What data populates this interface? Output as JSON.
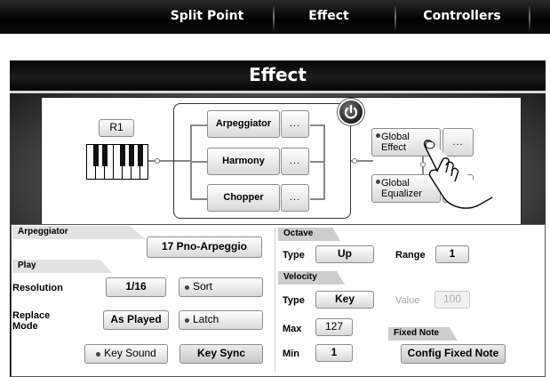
{
  "tabs": [
    {
      "label": "Split Point"
    },
    {
      "label": "Effect"
    },
    {
      "label": "Controllers"
    }
  ],
  "panel_title": "Effect",
  "routing": {
    "keyboard_label": "R1",
    "effects": [
      {
        "label": "Arpeggiator",
        "more": "..."
      },
      {
        "label": "Harmony",
        "more": "..."
      },
      {
        "label": "Chopper",
        "more": "..."
      }
    ],
    "global_effect": {
      "label": "Global Effect",
      "more": "..."
    },
    "global_equalizer": {
      "label": "Global Equalizer",
      "more": "..."
    },
    "power_icon": "power-icon"
  },
  "arpeggiator": {
    "header": "Arpeggiator",
    "preset": "17 Pno-Arpeggio",
    "play_header": "Play",
    "resolution_label": "Resolution",
    "resolution_value": "1/16",
    "sort_label": "Sort",
    "replace_mode_label": "Replace Mode",
    "replace_mode_value": "As Played",
    "latch_label": "Latch",
    "key_sound_label": "Key Sound",
    "key_sync_label": "Key Sync"
  },
  "octave": {
    "header": "Octave",
    "type_label": "Type",
    "type_value": "Up",
    "range_label": "Range",
    "range_value": "1"
  },
  "velocity": {
    "header": "Velocity",
    "type_label": "Type",
    "type_value": "Key",
    "value_label": "Value",
    "value_value": "100",
    "max_label": "Max",
    "max_value": "127",
    "min_label": "Min",
    "min_value": "1"
  },
  "fixed_note": {
    "header": "Fixed Note",
    "button_label": "Config Fixed Note"
  }
}
